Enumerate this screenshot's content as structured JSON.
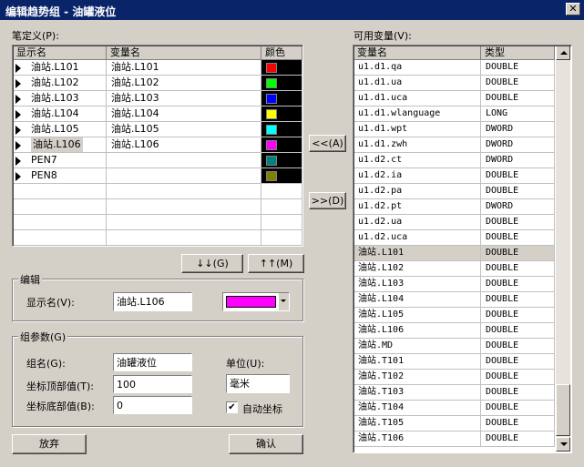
{
  "window": {
    "title": "编辑趋势组 - 油罐液位",
    "close_glyph": "✕"
  },
  "pens": {
    "label": "笔定义(P):",
    "columns": [
      "显示名",
      "变量名",
      "颜色"
    ],
    "rows": [
      {
        "display": "油站.L101",
        "variable": "油站.L101",
        "color": "#ff0000",
        "selected": false
      },
      {
        "display": "油站.L102",
        "variable": "油站.L102",
        "color": "#00ff00",
        "selected": false
      },
      {
        "display": "油站.L103",
        "variable": "油站.L103",
        "color": "#0000ff",
        "selected": false
      },
      {
        "display": "油站.L104",
        "variable": "油站.L104",
        "color": "#ffff00",
        "selected": false
      },
      {
        "display": "油站.L105",
        "variable": "油站.L105",
        "color": "#00ffff",
        "selected": false
      },
      {
        "display": "油站.L106",
        "variable": "油站.L106",
        "color": "#ff00ff",
        "selected": true
      },
      {
        "display": "PEN7",
        "variable": "",
        "color": "#008080",
        "selected": false
      },
      {
        "display": "PEN8",
        "variable": "",
        "color": "#808000",
        "selected": false
      }
    ],
    "move_down_label": "↓↓(G)",
    "move_up_label": "↑↑(M)"
  },
  "transfer": {
    "add_label": "<<(A)",
    "remove_label": ">>(D)"
  },
  "edit": {
    "group_title": "编辑",
    "display_name_label": "显示名(V):",
    "display_name_value": "油站.L106",
    "color_value": "#ff00ff"
  },
  "group_params": {
    "group_title": "组参数(G)",
    "name_label": "组名(G):",
    "name_value": "油罐液位",
    "top_label": "坐标顶部值(T):",
    "top_value": "100",
    "bottom_label": "坐标底部值(B):",
    "bottom_value": "0",
    "unit_label": "单位(U):",
    "unit_value": "毫米",
    "auto_label": "自动坐标",
    "auto_checked": true,
    "check_glyph": "✔"
  },
  "variables": {
    "label": "可用变量(V):",
    "columns": [
      "变量名",
      "类型"
    ],
    "rows": [
      {
        "name": "u1.d1.qa",
        "type": "DOUBLE",
        "selected": false
      },
      {
        "name": "u1.d1.ua",
        "type": "DOUBLE",
        "selected": false
      },
      {
        "name": "u1.d1.uca",
        "type": "DOUBLE",
        "selected": false
      },
      {
        "name": "u1.d1.wlanguage",
        "type": "LONG",
        "selected": false
      },
      {
        "name": "u1.d1.wpt",
        "type": "DWORD",
        "selected": false
      },
      {
        "name": "u1.d1.zwh",
        "type": "DWORD",
        "selected": false
      },
      {
        "name": "u1.d2.ct",
        "type": "DWORD",
        "selected": false
      },
      {
        "name": "u1.d2.ia",
        "type": "DOUBLE",
        "selected": false
      },
      {
        "name": "u1.d2.pa",
        "type": "DOUBLE",
        "selected": false
      },
      {
        "name": "u1.d2.pt",
        "type": "DWORD",
        "selected": false
      },
      {
        "name": "u1.d2.ua",
        "type": "DOUBLE",
        "selected": false
      },
      {
        "name": "u1.d2.uca",
        "type": "DOUBLE",
        "selected": false
      },
      {
        "name": "油站.L101",
        "type": "DOUBLE",
        "selected": true
      },
      {
        "name": "油站.L102",
        "type": "DOUBLE",
        "selected": false
      },
      {
        "name": "油站.L103",
        "type": "DOUBLE",
        "selected": false
      },
      {
        "name": "油站.L104",
        "type": "DOUBLE",
        "selected": false
      },
      {
        "name": "油站.L105",
        "type": "DOUBLE",
        "selected": false
      },
      {
        "name": "油站.L106",
        "type": "DOUBLE",
        "selected": false
      },
      {
        "name": "油站.MD",
        "type": "DOUBLE",
        "selected": false
      },
      {
        "name": "油站.T101",
        "type": "DOUBLE",
        "selected": false
      },
      {
        "name": "油站.T102",
        "type": "DOUBLE",
        "selected": false
      },
      {
        "name": "油站.T103",
        "type": "DOUBLE",
        "selected": false
      },
      {
        "name": "油站.T104",
        "type": "DOUBLE",
        "selected": false
      },
      {
        "name": "油站.T105",
        "type": "DOUBLE",
        "selected": false
      },
      {
        "name": "油站.T106",
        "type": "DOUBLE",
        "selected": false
      }
    ]
  },
  "footer": {
    "cancel_label": "放弃",
    "ok_label": "确认"
  },
  "colors": {
    "title_bar": "#0a246a",
    "face": "#d4d0c8",
    "selection": "#d4d0c8"
  }
}
